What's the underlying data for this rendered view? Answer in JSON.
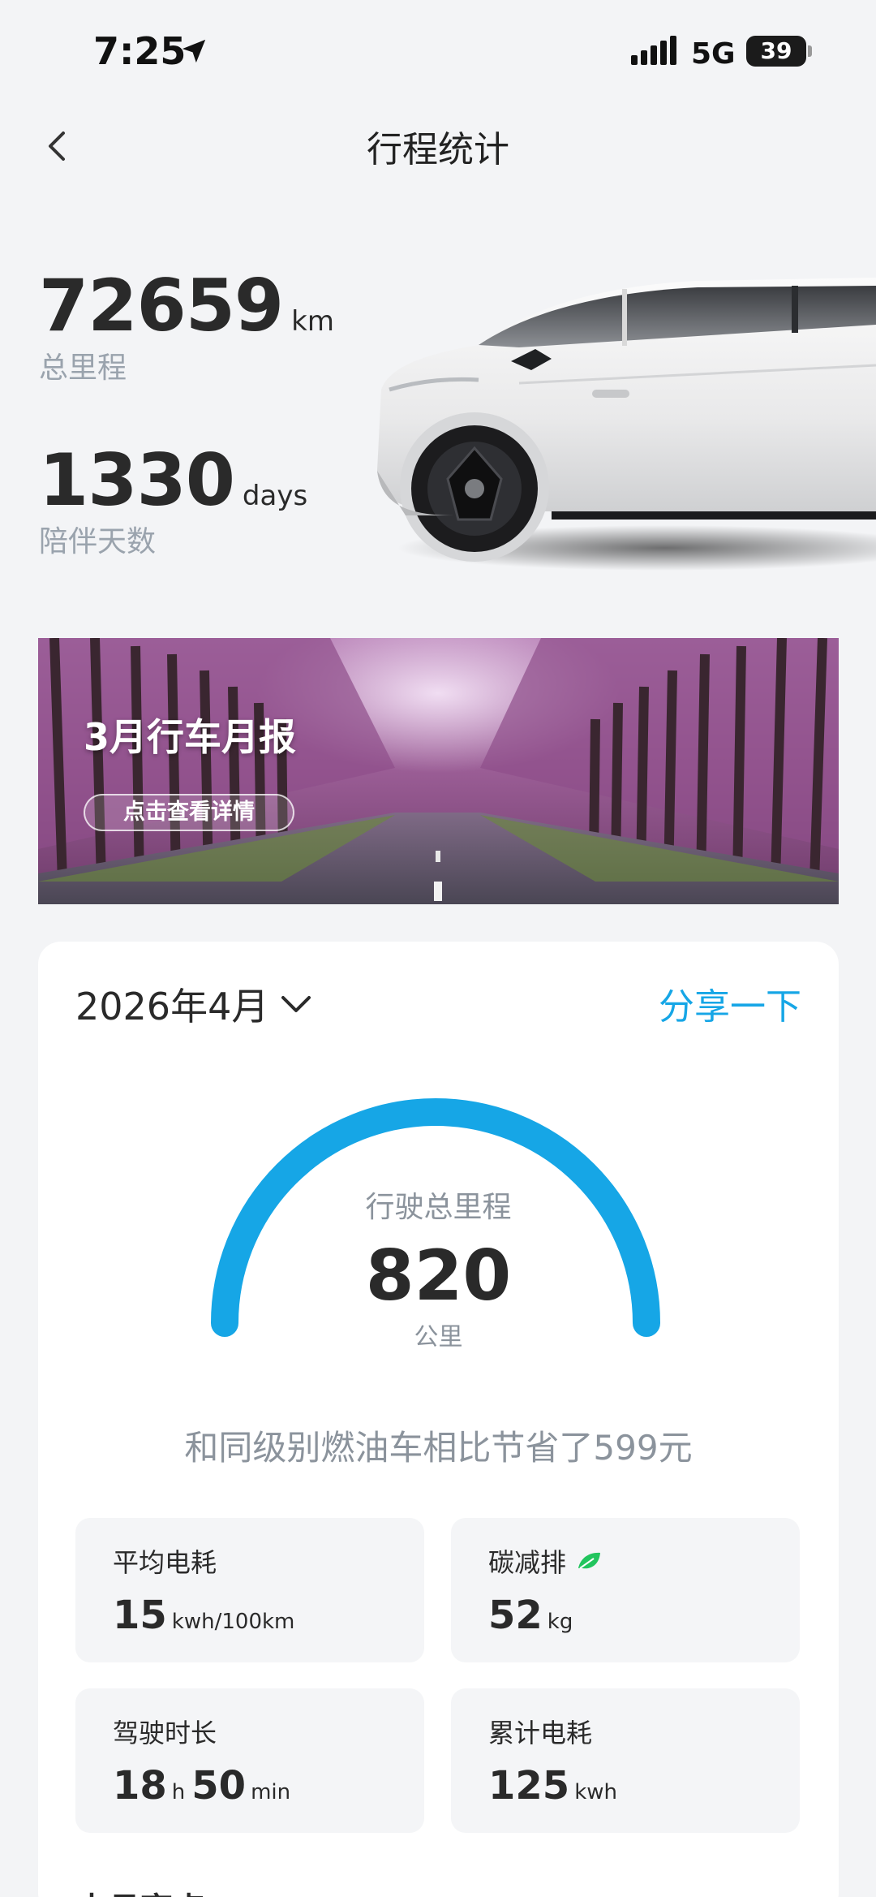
{
  "status": {
    "time": "7:25",
    "network": "5G",
    "battery": "39"
  },
  "nav": {
    "title": "行程统计"
  },
  "summary": {
    "total_distance": "72659",
    "distance_unit": "km",
    "distance_label": "总里程",
    "days": "1330",
    "days_unit": "days",
    "days_label": "陪伴天数"
  },
  "banner": {
    "title": "3月行车月报",
    "button": "点击查看详情"
  },
  "report": {
    "month": "2026年4月",
    "share": "分享一下",
    "gauge": {
      "label": "行驶总里程",
      "value": "820",
      "unit": "公里"
    },
    "saving_text": "和同级别燃油车相比节省了599元",
    "metrics": [
      {
        "title": "平均电耗",
        "value": "15",
        "unit": "kwh/100km"
      },
      {
        "title": "碳减排",
        "value": "52",
        "unit": "kg",
        "icon": "leaf-icon"
      },
      {
        "title": "驾驶时长",
        "value": "18",
        "unit": "h",
        "value2": "50",
        "unit2": "min"
      },
      {
        "title": "累计电耗",
        "value": "125",
        "unit": "kwh"
      }
    ],
    "next_section": "本月亮点"
  },
  "colors": {
    "accent": "#16a6e6",
    "leaf": "#22c55e",
    "background": "#f3f4f6"
  }
}
